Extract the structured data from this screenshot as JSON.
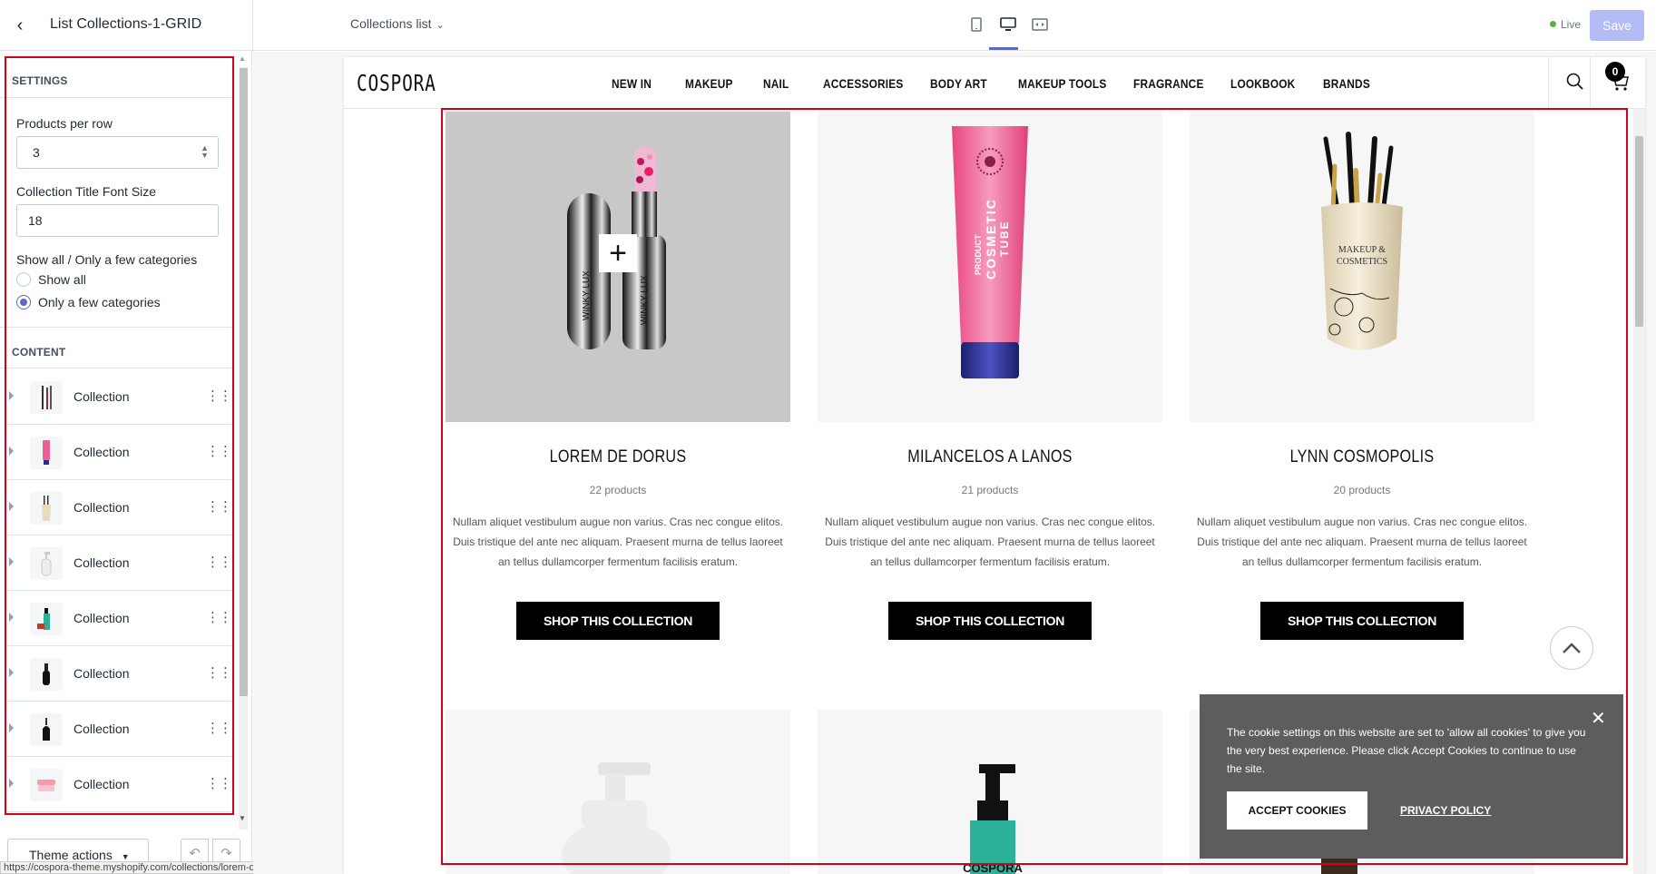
{
  "header": {
    "title": "List Collections-1-GRID",
    "template_select": "Collections list",
    "live_label": "Live",
    "save_label": "Save"
  },
  "sidebar": {
    "settings_heading": "SETTINGS",
    "products_per_row_label": "Products per row",
    "products_per_row_value": "3",
    "title_font_size_label": "Collection Title Font Size",
    "title_font_size_value": "18",
    "show_mode_label": "Show all / Only a few categories",
    "show_options": [
      {
        "label": "Show all",
        "selected": false
      },
      {
        "label": "Only a few categories",
        "selected": true
      }
    ],
    "content_heading": "CONTENT",
    "collections": [
      {
        "label": "Collection",
        "icon": "brushes-icon"
      },
      {
        "label": "Collection",
        "icon": "pink-tube-icon"
      },
      {
        "label": "Collection",
        "icon": "brush-vase-icon"
      },
      {
        "label": "Collection",
        "icon": "pump-bottle-icon"
      },
      {
        "label": "Collection",
        "icon": "teal-bottle-icon"
      },
      {
        "label": "Collection",
        "icon": "black-bottle-icon"
      },
      {
        "label": "Collection",
        "icon": "dropper-bottle-icon"
      },
      {
        "label": "Collection",
        "icon": "pink-jar-icon"
      }
    ],
    "theme_actions_label": "Theme actions"
  },
  "status_url": "https://cospora-theme.myshopify.com/collections/lorem-de-dorus",
  "store": {
    "logo": "COSPORA",
    "menu": [
      "NEW IN",
      "MAKEUP",
      "NAIL",
      "ACCESSORIES",
      "BODY ART",
      "MAKEUP TOOLS",
      "FRAGRANCE",
      "LOOKBOOK",
      "BRANDS"
    ],
    "cart_count": "0",
    "collections": [
      {
        "title": "LOREM DE DORUS",
        "count": "22 products",
        "description": "Nullam aliquet vestibulum augue non varius. Cras nec congue elitos. Duis tristique del ante nec aliquam. Praesent murna de tellus laoreet an tellus dullamcorper fermentum facilisis eratum.",
        "button": "SHOP THIS COLLECTION"
      },
      {
        "title": "MILANCELOS A LANOS",
        "count": "21 products",
        "description": "Nullam aliquet vestibulum augue non varius. Cras nec congue elitos. Duis tristique del ante nec aliquam. Praesent murna de tellus laoreet an tellus dullamcorper fermentum facilisis eratum.",
        "button": "SHOP THIS COLLECTION"
      },
      {
        "title": "LYNN COSMOPOLIS",
        "count": "20 products",
        "description": "Nullam aliquet vestibulum augue non varius. Cras nec congue elitos. Duis tristique del ante nec aliquam. Praesent murna de tellus laoreet an tellus dullamcorper fermentum facilisis eratum.",
        "button": "SHOP THIS COLLECTION"
      }
    ],
    "product_labels": {
      "lipstick_brand": "WINKY LUX",
      "tube_text_1": "PRODUCT",
      "tube_text_2": "COSMETIC",
      "tube_text_3": "TUBE",
      "vase_text_1": "MAKEUP &",
      "vase_text_2": "COSMETICS",
      "bottle_brand": "COSPORA"
    }
  },
  "cookie": {
    "message": "The cookie settings on this website are set to 'allow all cookies' to give you the very best experience. Please click Accept Cookies to continue to use the site.",
    "accept_label": "ACCEPT COOKIES",
    "policy_label": "PRIVACY POLICY"
  },
  "colors": {
    "accent": "#5c6ac4",
    "annotation_red": "#d0021b",
    "live_green": "#50b83c"
  }
}
